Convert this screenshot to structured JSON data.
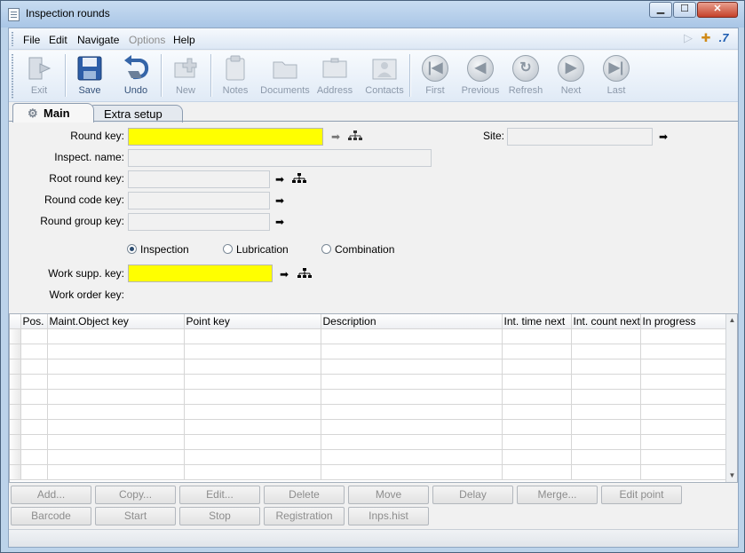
{
  "window": {
    "title": "Inspection rounds",
    "minimize_glyph": "▁",
    "maximize_glyph": "☐",
    "close_glyph": "✕"
  },
  "menu": {
    "file": "File",
    "edit": "Edit",
    "navigate": "Navigate",
    "options": "Options",
    "help": "Help",
    "right_glyph_a": "▷",
    "right_glyph_b": "✚",
    "right_glyph_c": ".7"
  },
  "toolbar": {
    "exit": "Exit",
    "save": "Save",
    "undo": "Undo",
    "new": "New",
    "notes": "Notes",
    "documents": "Documents",
    "address": "Address",
    "contacts": "Contacts",
    "first": "First",
    "previous": "Previous",
    "refresh": "Refresh",
    "next": "Next",
    "last": "Last",
    "first_glyph": "|◀",
    "previous_glyph": "◀",
    "refresh_glyph": "↻",
    "next_glyph": "▶",
    "last_glyph": "▶|"
  },
  "tabs": {
    "main": "Main",
    "extra": "Extra setup"
  },
  "form": {
    "round_key_label": "Round key:",
    "round_key_value": "",
    "inspect_name_label": "Inspect. name:",
    "inspect_name_value": "",
    "root_round_key_label": "Root round key:",
    "root_round_key_value": "",
    "round_code_key_label": "Round code key:",
    "round_code_key_value": "",
    "round_group_key_label": "Round group key:",
    "round_group_key_value": "",
    "site_label": "Site:",
    "site_value": "",
    "radio_inspection": "Inspection",
    "radio_lubrication": "Lubrication",
    "radio_combination": "Combination",
    "selected_type": "Inspection",
    "work_supp_key_label": "Work supp. key:",
    "work_supp_key_value": "",
    "work_order_key_label": "Work order key:",
    "arrow_glyph": "➡",
    "arrow_disabled_glyph": "➡",
    "required_color": "#ffff00"
  },
  "grid": {
    "columns": [
      "Pos.",
      "Maint.Object key",
      "Point key",
      "Description",
      "Int. time next",
      "Int. count next",
      "In progress"
    ],
    "row_count": 10,
    "scroll_up": "▲",
    "scroll_down": "▼"
  },
  "buttons": {
    "add": "Add...",
    "copy": "Copy...",
    "edit": "Edit...",
    "delete": "Delete",
    "move": "Move",
    "delay": "Delay",
    "merge": "Merge...",
    "edit_point": "Edit point",
    "barcode": "Barcode",
    "start": "Start",
    "stop": "Stop",
    "registration": "Registration",
    "inps_hist": "Inps.hist"
  }
}
